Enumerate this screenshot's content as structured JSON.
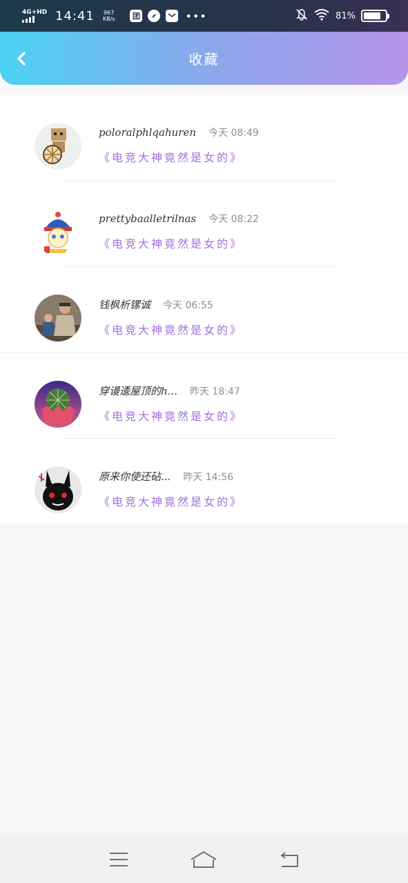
{
  "status_bar": {
    "network": "4G+HD",
    "time": "14:41",
    "speed_value": "967",
    "speed_unit": "KB/s",
    "app_icon_1": "团",
    "battery_percent": "81%",
    "battery_level": 0.81,
    "icons": [
      "signal-icon",
      "tuan-app-icon",
      "compass-app-icon",
      "mail-app-icon",
      "more-dots-icon",
      "mute-bell-icon",
      "wifi-icon",
      "battery-icon"
    ]
  },
  "header": {
    "title": "收藏",
    "back_icon": "chevron-left-icon",
    "gradient_start": "#4ad3f3",
    "gradient_end": "#b695ea"
  },
  "favorites": [
    {
      "name": "poloralphlqahuren",
      "time": "今天 08:49",
      "book": "《电竞大神竟然是女的》",
      "avatar": "cardboard-robot-avatar"
    },
    {
      "name": "prettybaalletrilnas",
      "time": "今天 08:22",
      "book": "《电竞大神竟然是女的》",
      "avatar": "cartoon-character-avatar"
    },
    {
      "name": "钱枫析镙诚",
      "time": "今天 06:55",
      "book": "《电竞大神竟然是女的》",
      "avatar": "parent-child-photo-avatar"
    },
    {
      "name": "穿谩逶屋顶的h...",
      "time": "昨天 18:47",
      "book": "《电竞大神竟然是女的》",
      "avatar": "cactus-photo-avatar"
    },
    {
      "name": "原来你使还砧...",
      "time": "昨天 14:56",
      "book": "《电竞大神竟然是女的》",
      "avatar": "black-bunny-avatar"
    }
  ],
  "accent_color": "#a46fe0",
  "bottom_nav": {
    "icons": [
      "menu-icon",
      "home-icon",
      "back-icon"
    ]
  }
}
